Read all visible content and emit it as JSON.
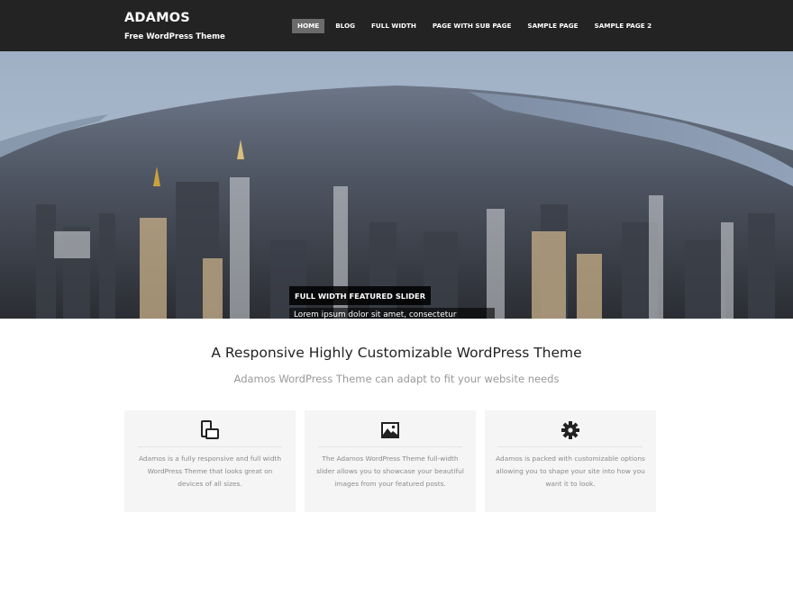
{
  "site": {
    "title": "ADAMOS",
    "description": "Free WordPress Theme"
  },
  "nav": {
    "items": [
      {
        "label": "HOME",
        "active": true
      },
      {
        "label": "BLOG",
        "active": false
      },
      {
        "label": "FULL WIDTH",
        "active": false
      },
      {
        "label": "PAGE WITH SUB PAGE",
        "active": false
      },
      {
        "label": "SAMPLE PAGE",
        "active": false
      },
      {
        "label": "SAMPLE PAGE 2",
        "active": false
      }
    ]
  },
  "slider": {
    "title": "FULL WIDTH FEATURED SLIDER",
    "text": "Lorem ipsum dolor sit amet, consectetur adipiscing elit. Cras quis est porta, imperdiet neque et, aliquet justo. Suspendisse ultrices tristique ..."
  },
  "intro": {
    "title": "A Responsive Highly Customizable WordPress Theme",
    "subtitle": "Adamos WordPress Theme can adapt to fit your website needs"
  },
  "features": [
    {
      "icon": "devices-icon",
      "text": "Adamos is a fully responsive and full width WordPress Theme that looks great on devices of all sizes."
    },
    {
      "icon": "image-icon",
      "text": "The Adamos WordPress Theme full-width slider allows you to showcase your beautiful images from your featured posts."
    },
    {
      "icon": "gear-icon",
      "text": "Adamos is packed with customizable options allowing you to shape your site into how you want it to look."
    }
  ],
  "colors": {
    "header_bg": "#232323",
    "nav_active_bg": "#6b6b6b",
    "feature_bg": "#f5f5f5",
    "muted_text": "#999999"
  }
}
